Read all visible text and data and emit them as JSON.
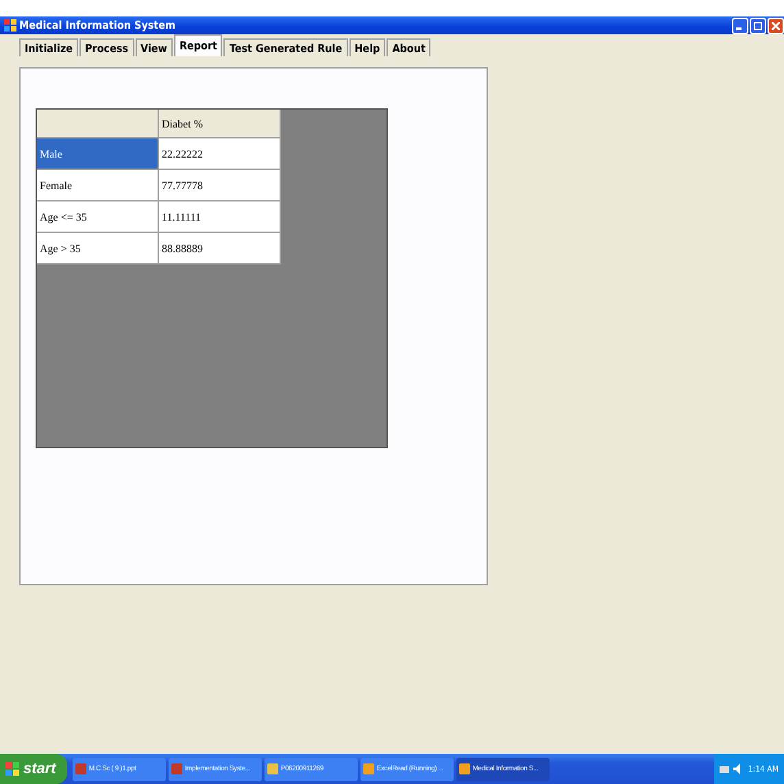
{
  "window": {
    "title": "Medical Information System"
  },
  "tabs": [
    {
      "label": "Initialize",
      "selected": false
    },
    {
      "label": "Process",
      "selected": false
    },
    {
      "label": "View",
      "selected": false
    },
    {
      "label": "Report",
      "selected": true
    },
    {
      "label": "Test Generated Rule",
      "selected": false
    },
    {
      "label": "Help",
      "selected": false
    },
    {
      "label": "About",
      "selected": false
    }
  ],
  "table": {
    "columns": [
      "Diabet %"
    ],
    "rows": [
      {
        "header": "Male",
        "value": "22.22222",
        "selected": true
      },
      {
        "header": "Female",
        "value": "77.77778",
        "selected": false
      },
      {
        "header": "Age <= 35",
        "value": "11.11111",
        "selected": false
      },
      {
        "header": "Age > 35",
        "value": "88.88889",
        "selected": false
      }
    ]
  },
  "taskbar": {
    "start": "start",
    "items": [
      {
        "label": "M.C.Sc ( 9 )1.ppt",
        "kind": "ppt",
        "selected": false
      },
      {
        "label": "Implementation Syste...",
        "kind": "ppt",
        "selected": false
      },
      {
        "label": "P06200911269",
        "kind": "folder",
        "selected": false
      },
      {
        "label": "ExcelRead (Running) ...",
        "kind": "app",
        "selected": false
      },
      {
        "label": "Medical Information S...",
        "kind": "app",
        "selected": true
      }
    ],
    "clock": "1:14 AM"
  }
}
